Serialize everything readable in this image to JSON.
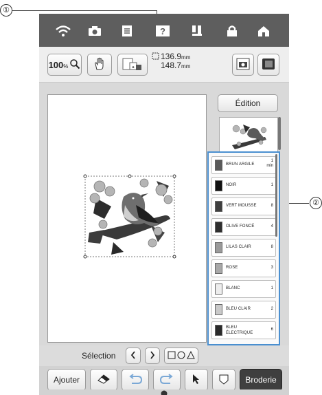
{
  "callouts": {
    "one": "①",
    "two": "②"
  },
  "toolbar": {
    "zoom_value": "100",
    "zoom_unit": "%",
    "width_value": "136.9",
    "height_value": "148.7",
    "unit": "mm"
  },
  "side": {
    "edit_label": "Édition"
  },
  "threads": [
    {
      "name": "BRUN ARGILE",
      "count": "1",
      "count_unit": "min",
      "color": "#5a5a5a"
    },
    {
      "name": "NOIR",
      "count": "1",
      "color": "#111111"
    },
    {
      "name": "VERT MOUSSE",
      "count": "8",
      "color": "#3f3f3f"
    },
    {
      "name": "OLIVE FONCÉ",
      "count": "4",
      "color": "#2e2e2e"
    },
    {
      "name": "LILAS CLAIR",
      "count": "8",
      "color": "#9a9a9a"
    },
    {
      "name": "ROSE",
      "count": "3",
      "color": "#a8a8a8"
    },
    {
      "name": "BLANC",
      "count": "1",
      "color": "#ededed"
    },
    {
      "name": "BLEU CLAIR",
      "count": "2",
      "color": "#c9c9c9"
    },
    {
      "name": "BLEU ÉLECTRIQUE",
      "count": "6",
      "color": "#2a2a2a"
    }
  ],
  "selection": {
    "label": "Sélection"
  },
  "bottom": {
    "add_label": "Ajouter",
    "embroider_label": "Broderie"
  },
  "colors": {
    "accent_frame": "#4a8fd0",
    "topbar": "#5e5e5e",
    "primary_button": "#3f3f3f"
  }
}
